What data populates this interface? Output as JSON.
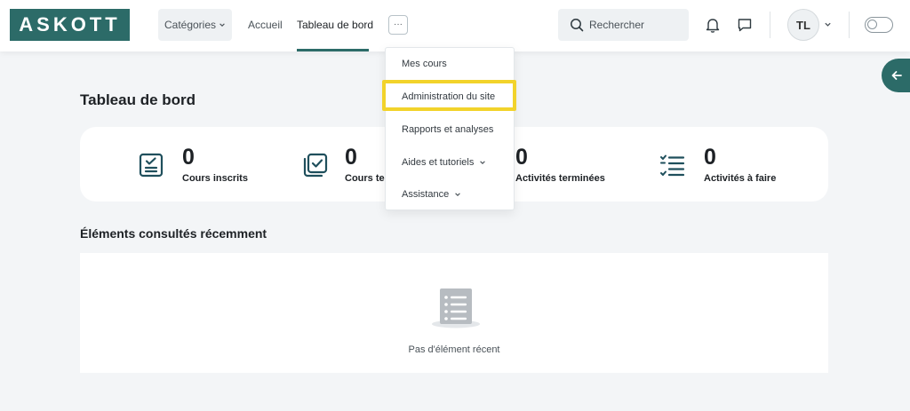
{
  "brand": {
    "logo_text": "ASKOTT",
    "color": "#2c6b68",
    "highlight_color": "#f2d32b"
  },
  "nav": {
    "categories_label": "Catégories",
    "accueil_label": "Accueil",
    "tableau_label": "Tableau de bord",
    "more_label": "···"
  },
  "search": {
    "placeholder": "Rechercher",
    "icon": "search-icon"
  },
  "header_icons": {
    "notifications": "bell-icon",
    "messages": "chat-icon"
  },
  "user": {
    "initials": "TL"
  },
  "dropdown": {
    "items": [
      {
        "label": "Mes cours",
        "has_chevron": false
      },
      {
        "label": "Administration du site",
        "has_chevron": false,
        "highlighted": true
      },
      {
        "label": "Rapports et analyses",
        "has_chevron": false
      },
      {
        "label": "Aides et tutoriels",
        "has_chevron": true
      },
      {
        "label": "Assistance",
        "has_chevron": true
      }
    ]
  },
  "main": {
    "title": "Tableau de bord",
    "stats": [
      {
        "value": "0",
        "label": "Cours inscrits",
        "icon": "checklist-icon"
      },
      {
        "value": "0",
        "label": "Cours te",
        "icon": "stacked-check-icon"
      },
      {
        "value": "0",
        "label": "Activités terminées",
        "icon": ""
      },
      {
        "value": "0",
        "label": "Activités à faire",
        "icon": "task-list-icon"
      }
    ],
    "recent_title": "Éléments consultés récemment",
    "recent_empty_text": "Pas d'élément récent"
  }
}
